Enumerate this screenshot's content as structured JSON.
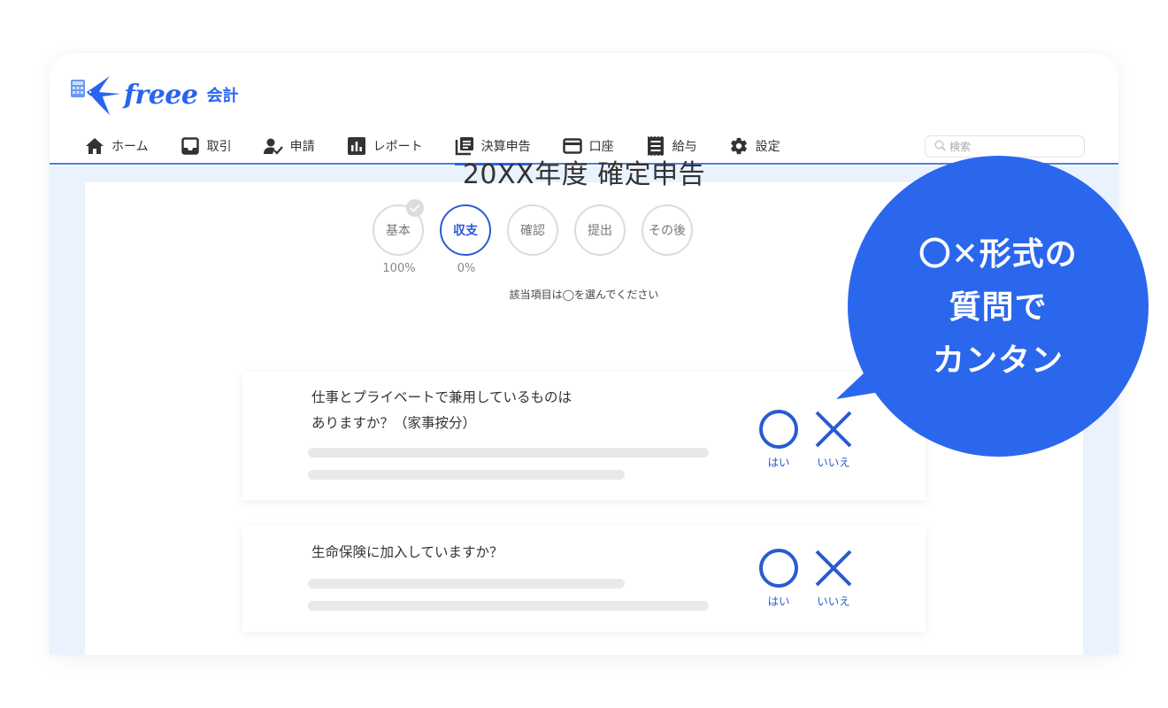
{
  "app": {
    "brand": "freee",
    "product": "会計"
  },
  "nav": {
    "items": [
      {
        "label": "ホーム",
        "icon": "home-icon",
        "active": false
      },
      {
        "label": "取引",
        "icon": "inbox-icon",
        "active": false
      },
      {
        "label": "申請",
        "icon": "user-check-icon",
        "active": false
      },
      {
        "label": "レポート",
        "icon": "bar-chart-icon",
        "active": false
      },
      {
        "label": "決算申告",
        "icon": "document-stack-icon",
        "active": true
      },
      {
        "label": "口座",
        "icon": "credit-card-icon",
        "active": false
      },
      {
        "label": "給与",
        "icon": "receipt-icon",
        "active": false
      },
      {
        "label": "設定",
        "icon": "gear-icon",
        "active": false
      }
    ],
    "search_placeholder": "検索"
  },
  "page": {
    "title": "20XX年度 確定申告",
    "steps": [
      {
        "label": "基本",
        "progress": "100%",
        "completed": true,
        "active": false
      },
      {
        "label": "収支",
        "progress": "0%",
        "completed": false,
        "active": true
      },
      {
        "label": "確認",
        "progress": "",
        "completed": false,
        "active": false
      },
      {
        "label": "提出",
        "progress": "",
        "completed": false,
        "active": false
      },
      {
        "label": "その後",
        "progress": "",
        "completed": false,
        "active": false
      }
    ],
    "instruction": "該当項目は◯を選んでください",
    "questions": [
      {
        "lines": [
          "仕事とプライベートで兼用しているものは",
          "ありますか？（家事按分）"
        ],
        "yes_label": "はい",
        "no_label": "いいえ"
      },
      {
        "lines": [
          "生命保険に加入していますか？"
        ],
        "yes_label": "はい",
        "no_label": "いいえ"
      }
    ]
  },
  "callout": {
    "lines": [
      "〇✕形式の",
      "質問で",
      "カンタン"
    ]
  },
  "colors": {
    "brand": "#2864f0",
    "accent": "#2a5bd0",
    "bubble": "#2b67ed",
    "nav_line": "#4b80e4",
    "content_bg": "#eaf2fd",
    "skeleton": "#e9e8ea"
  }
}
